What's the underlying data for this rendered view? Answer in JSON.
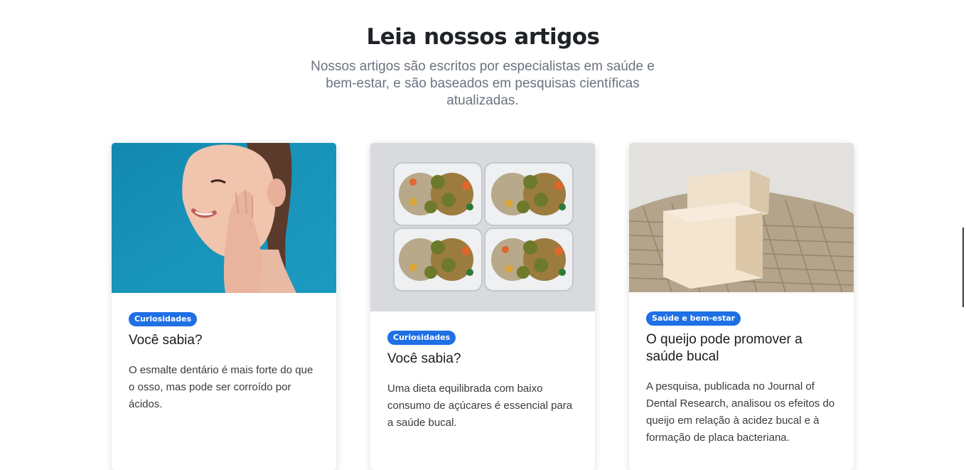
{
  "header": {
    "title": "Leia nossos artigos",
    "subtitle": "Nossos artigos são escritos por especialistas em saúde e bem-estar, e são baseados em pesquisas científicas atualizadas."
  },
  "articles": [
    {
      "image": "woman-touching-face-photo",
      "category": "Curiosidades",
      "title": "Você sabia?",
      "text": "O esmalte dentário é mais forte do que o osso, mas pode ser corroído por ácidos."
    },
    {
      "image": "meal-prep-containers-photo",
      "category": "Curiosidades",
      "title": "Você sabia?",
      "text": "Uma dieta equilibrada com baixo consumo de açúcares é essencial para a saúde bucal."
    },
    {
      "image": "cheese-on-net-photo",
      "category": "Saúde e bem-estar",
      "title": "O queijo pode promover a saúde bucal",
      "text": "A pesquisa, publicada no Journal of Dental Research, analisou os efeitos do queijo em relação à acidez bucal e à formação de placa bacteriana."
    }
  ],
  "colors": {
    "badge": "#1f6fe5",
    "title": "#1f2328",
    "subtitle": "#6b7280"
  }
}
